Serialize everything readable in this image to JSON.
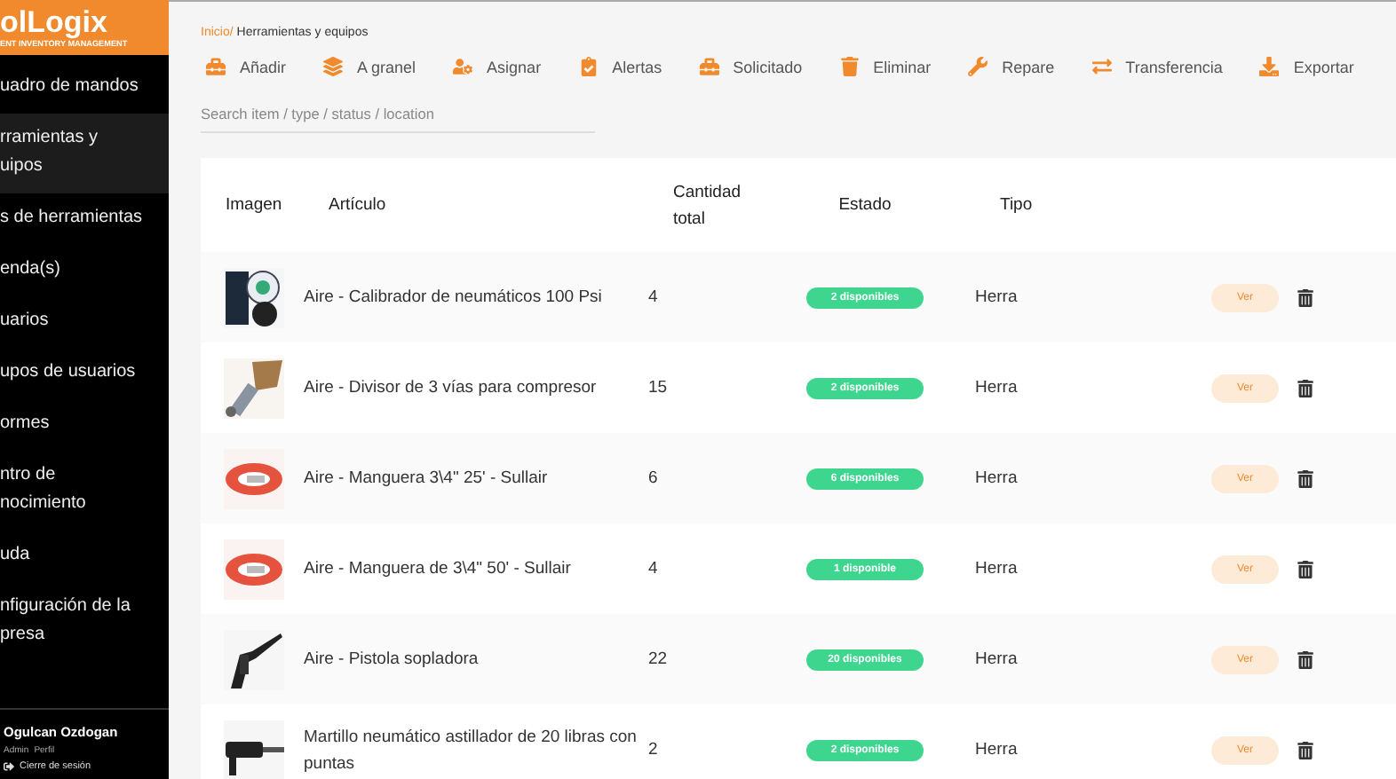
{
  "brand": {
    "name": "olLogix",
    "tagline": "ENT INVENTORY MANAGEMENT"
  },
  "sidebar": {
    "items": [
      {
        "lines": [
          "uadro de mandos"
        ],
        "selected": false
      },
      {
        "lines": [
          "rramientas y",
          "uipos"
        ],
        "selected": true
      },
      {
        "lines": [
          "s de herramientas"
        ],
        "selected": false
      },
      {
        "lines": [
          "enda(s)"
        ],
        "selected": false
      },
      {
        "lines": [
          "uarios"
        ],
        "selected": false
      },
      {
        "lines": [
          "upos de usuarios"
        ],
        "selected": false
      },
      {
        "lines": [
          "ormes"
        ],
        "selected": false
      },
      {
        "lines": [
          "ntro de",
          "nocimiento"
        ],
        "selected": false
      },
      {
        "lines": [
          "uda"
        ],
        "selected": false
      },
      {
        "lines": [
          "nfiguración de la",
          "presa"
        ],
        "selected": false
      }
    ],
    "user": {
      "name": "Ogulcan Ozdogan",
      "role": "Admin",
      "profile": "Perfil",
      "logout": "Cierre de sesión"
    }
  },
  "breadcrumb": {
    "root": "Inicio/",
    "current": "Herramientas y equipos"
  },
  "toolbar": [
    {
      "kind": "toolbox",
      "label": "Añadir"
    },
    {
      "kind": "layers",
      "label": "A granel"
    },
    {
      "kind": "user",
      "label": "Asignar"
    },
    {
      "kind": "clipboard",
      "label": "Alertas"
    },
    {
      "kind": "toolbox",
      "label": "Solicitado"
    },
    {
      "kind": "trash",
      "label": "Eliminar"
    },
    {
      "kind": "wrench",
      "label": "Repare"
    },
    {
      "kind": "transfer",
      "label": "Transferencia"
    },
    {
      "kind": "download",
      "label": "Exportar"
    }
  ],
  "search": {
    "placeholder": "Search item / type / status / location"
  },
  "table": {
    "columns": [
      "Imagen",
      "Artículo",
      "Cantidad total",
      "Estado",
      "Tipo"
    ],
    "rows": [
      {
        "item": "Aire - Calibrador de neumáticos 100 Psi",
        "qty": "4",
        "status": "2 disponibles",
        "type": "Herra",
        "action": "Ver"
      },
      {
        "item": "Aire - Divisor de 3 vías para compresor",
        "qty": "15",
        "status": "2 disponibles",
        "type": "Herra",
        "action": "Ver"
      },
      {
        "item": "Aire - Manguera 3\\4\" 25' - Sullair",
        "qty": "6",
        "status": "6 disponibles",
        "type": "Herra",
        "action": "Ver"
      },
      {
        "item": "Aire - Manguera de 3\\4\" 50' - Sullair",
        "qty": "4",
        "status": "1 disponible",
        "type": "Herra",
        "action": "Ver"
      },
      {
        "item": "Aire - Pistola sopladora",
        "qty": "22",
        "status": "20 disponibles",
        "type": "Herra",
        "action": "Ver"
      },
      {
        "item": "Martillo neumático astillador de 20 libras con puntas",
        "qty": "2",
        "status": "2 disponibles",
        "type": "Herra",
        "action": "Ver"
      }
    ]
  }
}
